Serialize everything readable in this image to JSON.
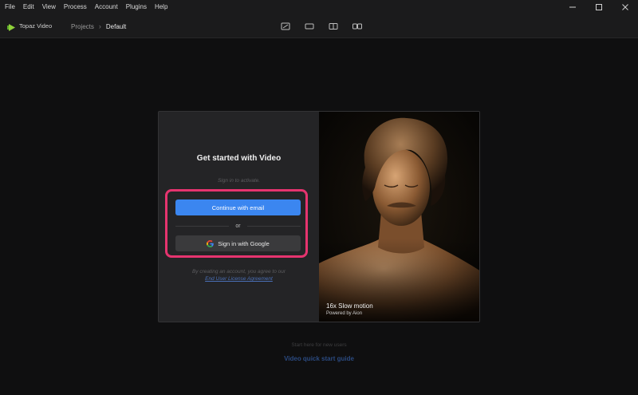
{
  "menubar": {
    "items": [
      "File",
      "Edit",
      "View",
      "Process",
      "Account",
      "Plugins",
      "Help"
    ],
    "window_controls": [
      "minimize-icon",
      "maximize-icon",
      "close-icon"
    ]
  },
  "toolbar": {
    "app_name": "Topaz Video",
    "breadcrumb": {
      "projects": "Projects",
      "current": "Default"
    },
    "view_modes": [
      "crop-view-icon",
      "single-view-icon",
      "split-view-icon",
      "side-by-side-view-icon"
    ]
  },
  "signin": {
    "title": "Get started with Video",
    "subtitle": "Sign in to activate.",
    "email_button": "Continue with email",
    "or_text": "or",
    "google_button": "Sign in with Google",
    "legal_text": "By creating an account, you agree to our",
    "eula_link": "End User License Agreement"
  },
  "promo": {
    "caption_title": "16x Slow motion",
    "caption_sub": "Powered by Aion"
  },
  "footer": {
    "start_here": "Start here for new users",
    "quick_start": "Video quick start guide"
  },
  "colors": {
    "accent": "#3b86f0",
    "highlight": "#e6346f",
    "background": "#0f0f10"
  }
}
